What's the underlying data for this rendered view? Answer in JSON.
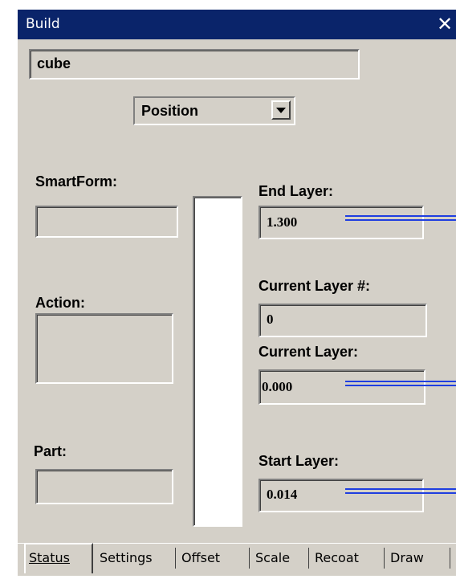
{
  "window": {
    "title": "Build",
    "close_glyph": "✕"
  },
  "name_field": {
    "value": "cube"
  },
  "mode_select": {
    "value": "Position"
  },
  "left": {
    "smartform_label": "SmartForm:",
    "action_label": "Action:",
    "part_label": "Part:"
  },
  "right": {
    "end_layer_label": "End Layer:",
    "end_layer_value": "1.300",
    "current_layer_num_label": "Current Layer #:",
    "current_layer_num_value": "0",
    "current_layer_label": "Current Layer:",
    "current_layer_value": "0.000",
    "start_layer_label": "Start Layer:",
    "start_layer_value": "0.014"
  },
  "tabs": [
    "Status",
    "Settings",
    "Offset",
    "Scale",
    "Recoat",
    "Draw"
  ],
  "colors": {
    "titlebar": "#0a246a",
    "face": "#d4d0c8",
    "indicator": "#1f3ee0"
  }
}
